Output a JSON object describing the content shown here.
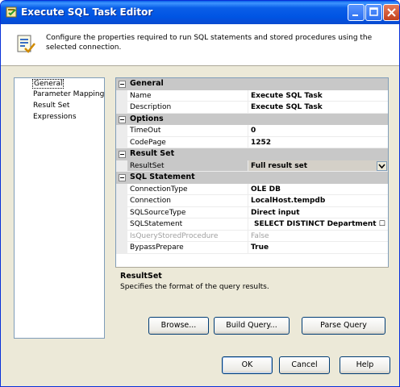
{
  "window": {
    "title": "Execute SQL Task Editor"
  },
  "header": {
    "description": "Configure the properties required to run SQL statements and stored procedures using the selected connection."
  },
  "nav": {
    "items": [
      "General",
      "Parameter Mapping",
      "Result Set",
      "Expressions"
    ],
    "selected": "General"
  },
  "grid": {
    "categories": {
      "general": "General",
      "options": "Options",
      "result_set": "Result Set",
      "sql_statement": "SQL Statement"
    },
    "rows": {
      "name": {
        "label": "Name",
        "value": "Execute SQL Task"
      },
      "description": {
        "label": "Description",
        "value": "Execute SQL Task"
      },
      "timeout": {
        "label": "TimeOut",
        "value": "0"
      },
      "codepage": {
        "label": "CodePage",
        "value": "1252"
      },
      "resultset": {
        "label": "ResultSet",
        "value": "Full result set"
      },
      "connectiontype": {
        "label": "ConnectionType",
        "value": "OLE DB"
      },
      "connection": {
        "label": "Connection",
        "value": "LocalHost.tempdb"
      },
      "sqlsourcetype": {
        "label": "SQLSourceType",
        "value": "Direct input"
      },
      "sqlstatement": {
        "label": "SQLStatement",
        "value": "SELECT DISTINCT Department ☐  F"
      },
      "isquerystoredprocedure": {
        "label": "IsQueryStoredProcedure",
        "value": "False"
      },
      "bypassprepare": {
        "label": "BypassPrepare",
        "value": "True"
      }
    }
  },
  "description_panel": {
    "title": "ResultSet",
    "text": "Specifies the format of the query results."
  },
  "buttons": {
    "browse": "Browse...",
    "build_query": "Build Query...",
    "parse_query": "Parse Query",
    "ok": "OK",
    "cancel": "Cancel",
    "help": "Help"
  },
  "colors": {
    "title_bar": "#0054e3",
    "category_bg": "#c8c8c8",
    "selection_bg": "#d4d0c8",
    "dialog_bg": "#ece9d8"
  }
}
